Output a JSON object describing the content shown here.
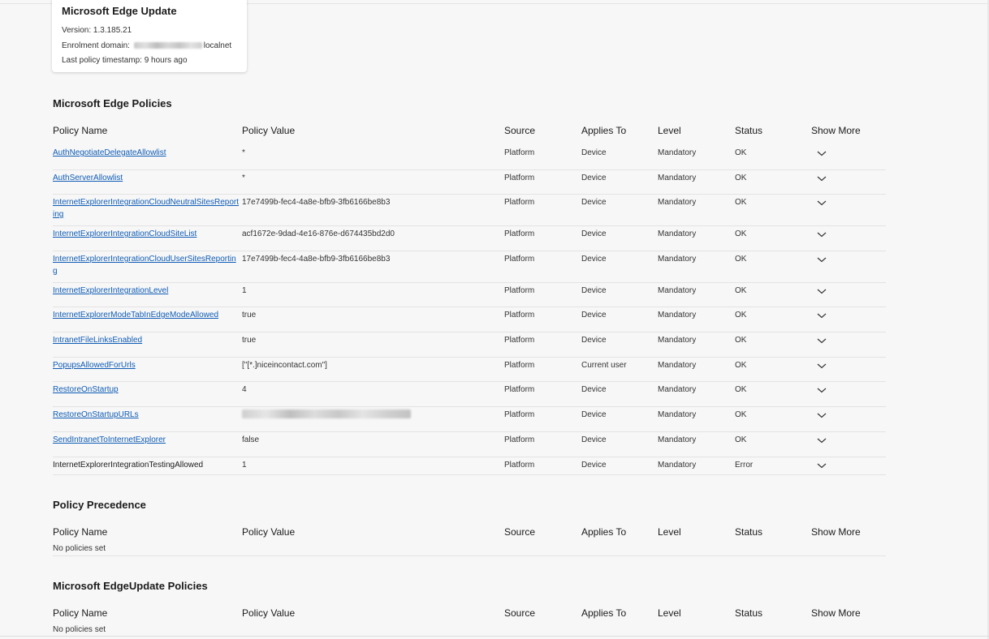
{
  "update_card": {
    "title": "Microsoft Edge Update",
    "version": "Version: 1.3.185.21",
    "enrolment_prefix": "Enrolment domain: ",
    "enrolment_suffix": "localnet",
    "timestamp": "Last policy timestamp: 9 hours ago"
  },
  "columns": {
    "name": "Policy Name",
    "value": "Policy Value",
    "source": "Source",
    "applies": "Applies To",
    "level": "Level",
    "status": "Status",
    "more": "Show More"
  },
  "sections": {
    "edge_policies": "Microsoft Edge Policies",
    "precedence": "Policy Precedence",
    "edgeupdate": "Microsoft EdgeUpdate Policies"
  },
  "empty_text": "No policies set",
  "policies": [
    {
      "name": "AuthNegotiateDelegateAllowlist",
      "value": "*",
      "source": "Platform",
      "applies": "Device",
      "level": "Mandatory",
      "status": "OK",
      "link": true
    },
    {
      "name": "AuthServerAllowlist",
      "value": "*",
      "source": "Platform",
      "applies": "Device",
      "level": "Mandatory",
      "status": "OK",
      "link": true
    },
    {
      "name": "InternetExplorerIntegrationCloudNeutralSitesReporting",
      "value": "17e7499b-fec4-4a8e-bfb9-3fb6166be8b3",
      "source": "Platform",
      "applies": "Device",
      "level": "Mandatory",
      "status": "OK",
      "link": true
    },
    {
      "name": "InternetExplorerIntegrationCloudSiteList",
      "value": "acf1672e-9dad-4e16-876e-d674435bd2d0",
      "source": "Platform",
      "applies": "Device",
      "level": "Mandatory",
      "status": "OK",
      "link": true
    },
    {
      "name": "InternetExplorerIntegrationCloudUserSitesReporting",
      "value": "17e7499b-fec4-4a8e-bfb9-3fb6166be8b3",
      "source": "Platform",
      "applies": "Device",
      "level": "Mandatory",
      "status": "OK",
      "link": true
    },
    {
      "name": "InternetExplorerIntegrationLevel",
      "value": "1",
      "source": "Platform",
      "applies": "Device",
      "level": "Mandatory",
      "status": "OK",
      "link": true
    },
    {
      "name": "InternetExplorerModeTabInEdgeModeAllowed",
      "value": "true",
      "source": "Platform",
      "applies": "Device",
      "level": "Mandatory",
      "status": "OK",
      "link": true
    },
    {
      "name": "IntranetFileLinksEnabled",
      "value": "true",
      "source": "Platform",
      "applies": "Device",
      "level": "Mandatory",
      "status": "OK",
      "link": true
    },
    {
      "name": "PopupsAllowedForUrls",
      "value": "[\"[*.]niceincontact.com\"]",
      "source": "Platform",
      "applies": "Current user",
      "level": "Mandatory",
      "status": "OK",
      "link": true
    },
    {
      "name": "RestoreOnStartup",
      "value": "4",
      "source": "Platform",
      "applies": "Device",
      "level": "Mandatory",
      "status": "OK",
      "link": true
    },
    {
      "name": "RestoreOnStartupURLs",
      "value": "",
      "source": "Platform",
      "applies": "Device",
      "level": "Mandatory",
      "status": "OK",
      "link": true
    },
    {
      "name": "SendIntranetToInternetExplorer",
      "value": "false",
      "source": "Platform",
      "applies": "Device",
      "level": "Mandatory",
      "status": "OK",
      "link": true
    },
    {
      "name": "InternetExplorerIntegrationTestingAllowed",
      "value": "1",
      "source": "Platform",
      "applies": "Device",
      "level": "Mandatory",
      "status": "Error",
      "link": false
    }
  ],
  "colors": {
    "link": "#0f5cb5",
    "text": "#1b1b1b",
    "background": "#f7f7f7"
  }
}
